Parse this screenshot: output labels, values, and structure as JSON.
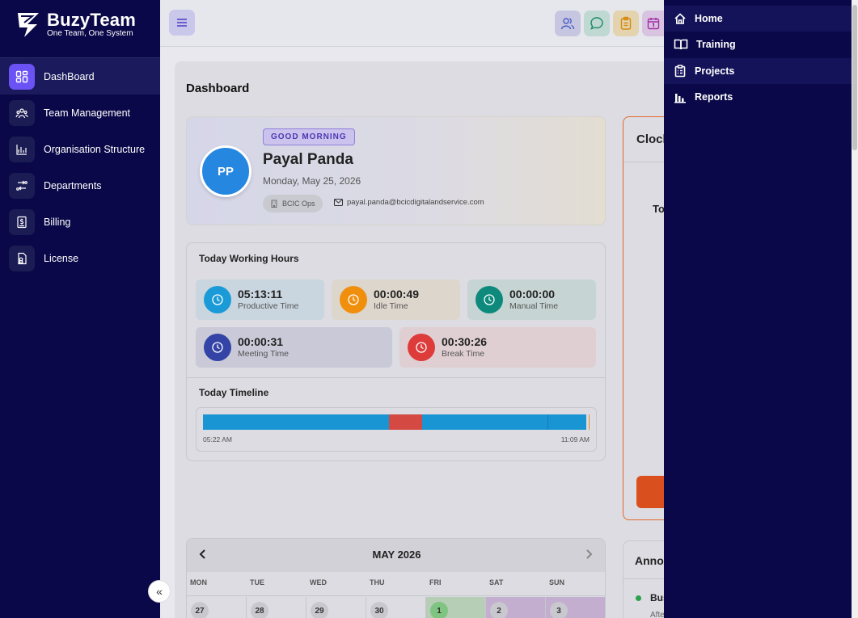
{
  "brand": {
    "name": "BuzyTeam",
    "tagline": "One Team, One System"
  },
  "sidebar": {
    "items": [
      {
        "label": "DashBoard",
        "icon": "dashboard-icon",
        "active": true
      },
      {
        "label": "Team Management",
        "icon": "team-icon"
      },
      {
        "label": "Organisation Structure",
        "icon": "org-chart-icon"
      },
      {
        "label": "Departments",
        "icon": "departments-icon"
      },
      {
        "label": "Billing",
        "icon": "billing-icon"
      },
      {
        "label": "License",
        "icon": "license-icon"
      }
    ],
    "collapse_glyph": "«"
  },
  "header": {
    "menu_icon": "hamburger-icon",
    "actions": [
      "users-icon",
      "chat-icon",
      "clipboard-icon",
      "calendar-icon"
    ]
  },
  "page": {
    "title": "Dashboard"
  },
  "profile": {
    "greeting": "GOOD MORNING",
    "initials": "PP",
    "name": "Payal Panda",
    "date": "Monday, May 25, 2026",
    "department": "BCIC Ops",
    "email": "payal.panda@bcicdigitalandservice.com"
  },
  "working_hours": {
    "title": "Today Working Hours",
    "stats": [
      {
        "value": "05:13:11",
        "label": "Productive Time",
        "color": "#1a9ad6"
      },
      {
        "value": "00:00:49",
        "label": "Idle Time",
        "color": "#ef8f0c"
      },
      {
        "value": "00:00:00",
        "label": "Manual Time",
        "color": "#0e8a7c"
      },
      {
        "value": "00:00:31",
        "label": "Meeting Time",
        "color": "#3343a6"
      },
      {
        "value": "00:30:26",
        "label": "Break Time",
        "color": "#de3b3b"
      }
    ]
  },
  "timeline": {
    "title": "Today Timeline",
    "start": "05:22 AM",
    "end": "11:09 AM"
  },
  "clock": {
    "title_partial": "Clock",
    "label_partial": "To"
  },
  "calendar": {
    "month": "MAY 2026",
    "days": [
      "MON",
      "TUE",
      "WED",
      "THU",
      "FRI",
      "SAT",
      "SUN"
    ],
    "first_row": [
      "27",
      "28",
      "29",
      "30",
      "1",
      "2",
      "3"
    ]
  },
  "announcements": {
    "title_partial": "Anno",
    "item_partial": "Bus",
    "sub_partial": "Afte"
  },
  "dropdown": {
    "items": [
      {
        "label": "Home",
        "icon": "home-icon"
      },
      {
        "label": "Training",
        "icon": "book-icon"
      },
      {
        "label": "Projects",
        "icon": "projects-icon"
      },
      {
        "label": "Reports",
        "icon": "reports-icon"
      }
    ]
  }
}
